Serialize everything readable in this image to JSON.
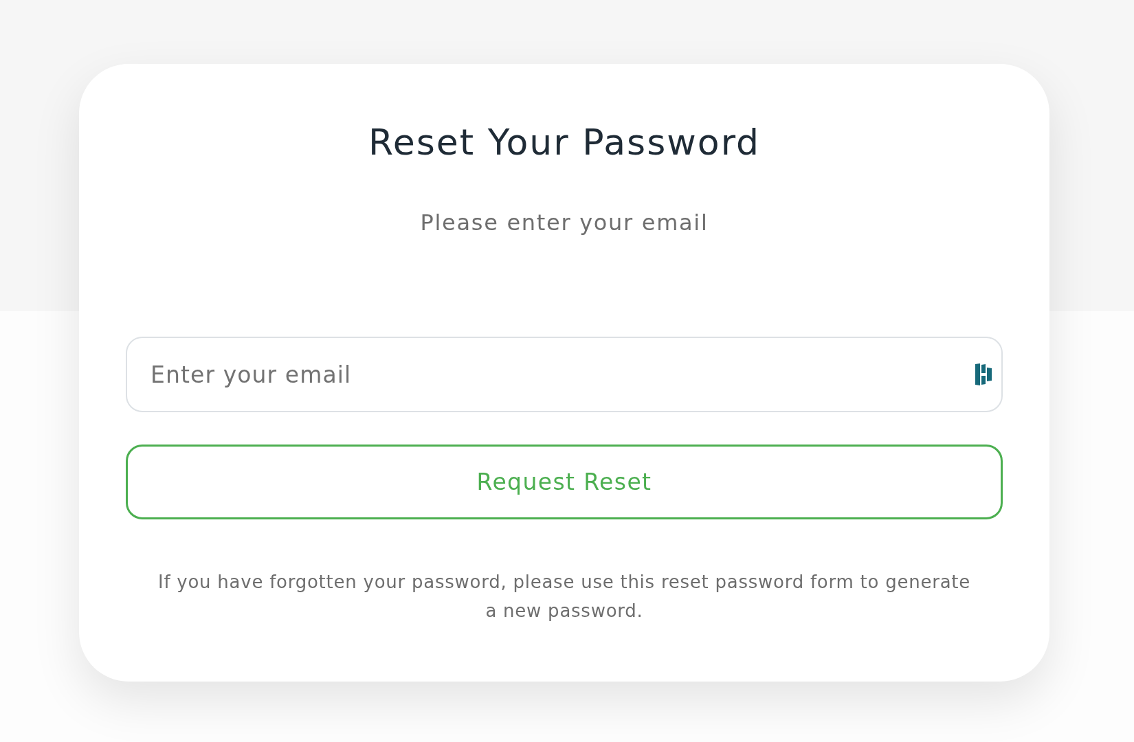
{
  "card": {
    "title": "Reset Your Password",
    "subtitle": "Please enter your email",
    "email_field": {
      "placeholder": "Enter your email"
    },
    "button": "Request Reset",
    "help_text": "If you have forgotten your password, please use this reset password form to generate a new password."
  }
}
